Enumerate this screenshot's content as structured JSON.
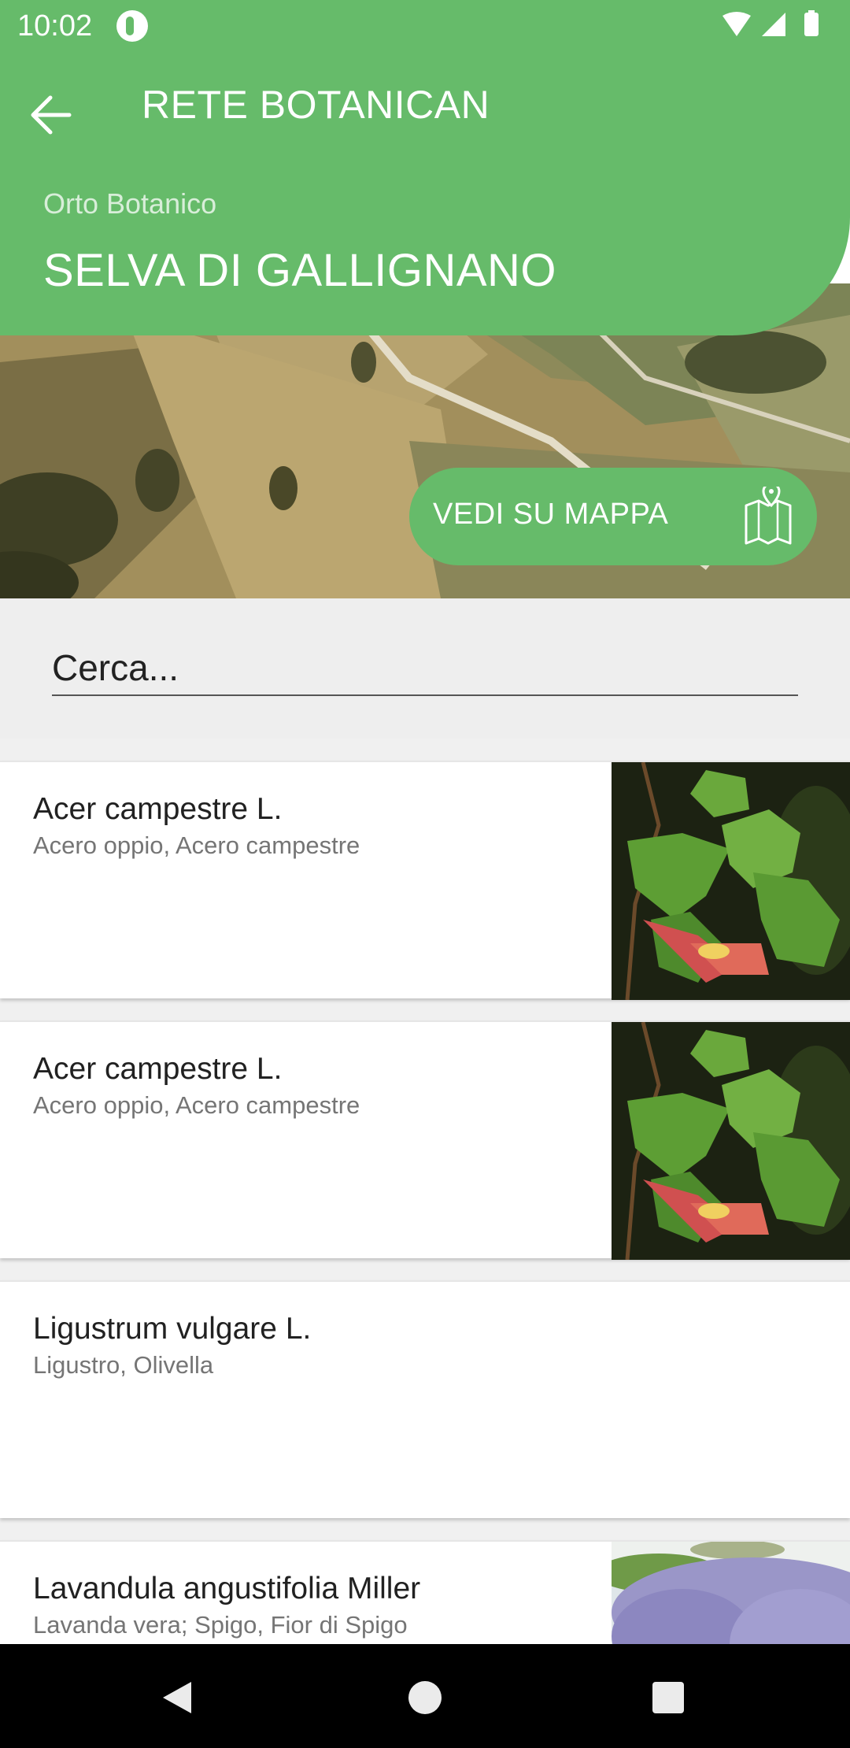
{
  "status_bar": {
    "time": "10:02",
    "icons": [
      "app-notification-icon",
      "wifi-icon",
      "signal-icon",
      "battery-icon"
    ]
  },
  "header": {
    "back_icon": "arrow-left-icon",
    "title": "RETE BOTANICAN",
    "subtitle": "Orto Botanico",
    "garden_name": "SELVA DI GALLIGNANO",
    "color": "#66bb6a"
  },
  "map_button": {
    "label": "VEDI SU MAPPA",
    "icon": "map-pin-icon"
  },
  "search": {
    "placeholder": "Cerca..."
  },
  "plants": [
    {
      "title": "Acer campestre L.",
      "subtitle": "Acero oppio, Acero campestre",
      "image": "maple-leaf-photo"
    },
    {
      "title": "Acer campestre L.",
      "subtitle": "Acero oppio, Acero campestre",
      "image": "maple-leaf-photo"
    },
    {
      "title": "Ligustrum vulgare L.",
      "subtitle": "Ligustro, Olivella",
      "image": ""
    },
    {
      "title": "Lavandula angustifolia Miller",
      "subtitle": "Lavanda vera; Spigo, Fior di Spigo",
      "image": "lavender-photo"
    }
  ],
  "nav_bar": {
    "icons": [
      "nav-back-icon",
      "nav-home-icon",
      "nav-recents-icon"
    ]
  }
}
